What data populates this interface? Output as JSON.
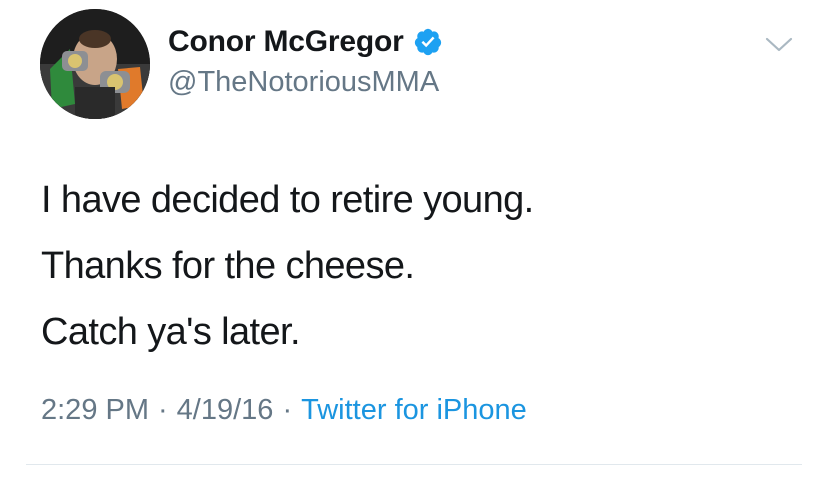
{
  "tweet": {
    "author": {
      "display_name": "Conor McGregor",
      "handle": "@TheNotoriousMMA",
      "verified": true,
      "verified_icon": "verified-badge-icon",
      "avatar": "profile-photo"
    },
    "menu_icon": "chevron-down-icon",
    "text_lines": [
      "I have decided to retire young.",
      "Thanks for the cheese.",
      "Catch ya's later."
    ],
    "meta": {
      "time": "2:29 PM",
      "date": "4/19/16",
      "separator": "·",
      "source": "Twitter for iPhone"
    }
  },
  "colors": {
    "text_primary": "#14171a",
    "text_secondary": "#657786",
    "link_blue": "#1b95e0",
    "verified_blue": "#1da1f2",
    "divider": "#e1e8ed"
  }
}
